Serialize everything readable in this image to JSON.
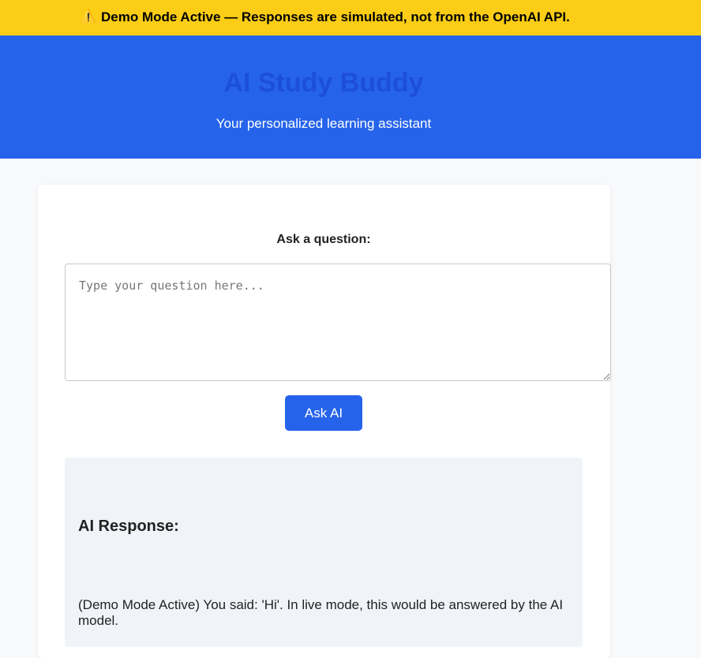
{
  "banner": {
    "icon": "warning-icon",
    "icon_glyph": "⚠️",
    "text": "Demo Mode Active — Responses are simulated, not from the OpenAI API.",
    "background": "#fbcd16"
  },
  "header": {
    "title": "AI Study Buddy",
    "subtitle": "Your personalized learning assistant",
    "background": "#2563eb",
    "title_color": "#1d4fd8"
  },
  "form": {
    "label": "Ask a question:",
    "question_value": "",
    "question_placeholder": "Type your question here...",
    "ask_button_label": "Ask AI",
    "button_color": "#2563eb"
  },
  "response": {
    "title": "AI Response:",
    "text": "(Demo Mode Active) You said: 'Hi'. In live mode, this would be answered by the AI model.",
    "background": "#f0f3f8"
  }
}
